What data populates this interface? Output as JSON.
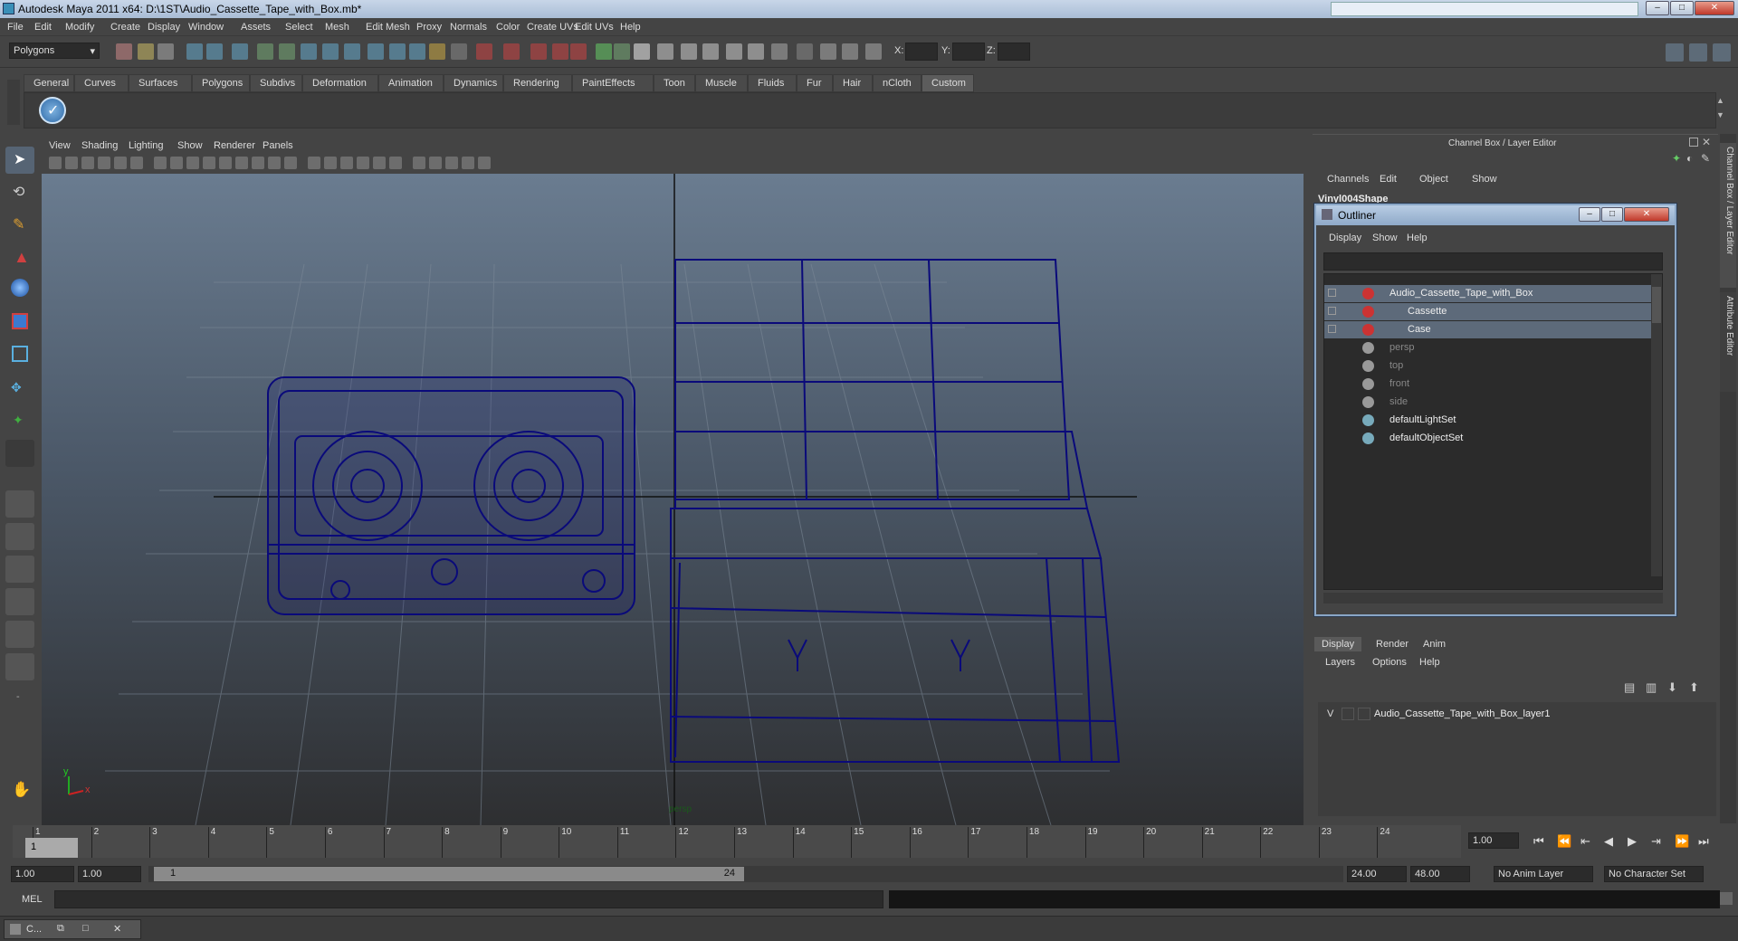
{
  "window": {
    "title": "Autodesk Maya 2011 x64: D:\\1ST\\Audio_Cassette_Tape_with_Box.mb*",
    "minimize": "–",
    "maximize": "□",
    "close": "✕"
  },
  "menubar": [
    "File",
    "Edit",
    "Modify",
    "Create",
    "Display",
    "Window",
    "Assets",
    "Select",
    "Mesh",
    "Edit Mesh",
    "Proxy",
    "Normals",
    "Color",
    "Create UVs",
    "Edit UVs",
    "Help"
  ],
  "status_line": {
    "mode": "Polygons",
    "x_label": "X:",
    "y_label": "Y:",
    "z_label": "Z:"
  },
  "shelf_tabs": [
    "General",
    "Curves",
    "Surfaces",
    "Polygons",
    "Subdivs",
    "Deformation",
    "Animation",
    "Dynamics",
    "Rendering",
    "PaintEffects",
    "Toon",
    "Muscle",
    "Fluids",
    "Fur",
    "Hair",
    "nCloth",
    "Custom"
  ],
  "active_shelf_tab": "Custom",
  "viewport": {
    "menu": [
      "View",
      "Shading",
      "Lighting",
      "Show",
      "Renderer",
      "Panels"
    ],
    "camera_label": "persp",
    "axis_x": "x",
    "axis_y": "y"
  },
  "channel_box": {
    "header": "Channel Box / Layer Editor",
    "menu": [
      "Channels",
      "Edit",
      "Object",
      "Show"
    ],
    "object_name": "Vinyl004Shape",
    "side_tab_1": "Channel Box / Layer Editor",
    "side_tab_2": "Attribute Editor"
  },
  "outliner": {
    "title": "Outliner",
    "menu": [
      "Display",
      "Show",
      "Help"
    ],
    "items": [
      {
        "label": "Audio_Cassette_Tape_with_Box",
        "selected": true,
        "dim": false
      },
      {
        "label": "Cassette",
        "selected": true,
        "dim": false
      },
      {
        "label": "Case",
        "selected": true,
        "dim": false
      },
      {
        "label": "persp",
        "selected": false,
        "dim": true
      },
      {
        "label": "top",
        "selected": false,
        "dim": true
      },
      {
        "label": "front",
        "selected": false,
        "dim": true
      },
      {
        "label": "side",
        "selected": false,
        "dim": true
      },
      {
        "label": "defaultLightSet",
        "selected": false,
        "dim": false
      },
      {
        "label": "defaultObjectSet",
        "selected": false,
        "dim": false
      }
    ]
  },
  "layer_editor": {
    "tabs": [
      "Display",
      "Render",
      "Anim"
    ],
    "menu": [
      "Layers",
      "Options",
      "Help"
    ],
    "layer_visible": "V",
    "layer_name": "Audio_Cassette_Tape_with_Box_layer1"
  },
  "time_slider": {
    "ticks": [
      "1",
      "2",
      "3",
      "4",
      "5",
      "6",
      "7",
      "8",
      "9",
      "10",
      "11",
      "12",
      "13",
      "14",
      "15",
      "16",
      "17",
      "18",
      "19",
      "20",
      "21",
      "22",
      "23",
      "24"
    ],
    "current_frame": "1",
    "current_time_field": "1.00"
  },
  "range_slider": {
    "start_time": "1.00",
    "playback_start": "1.00",
    "range_start_label": "1",
    "range_end_label": "24",
    "playback_end": "24.00",
    "end_time": "48.00",
    "anim_layer": "No Anim Layer",
    "character_set": "No Character Set"
  },
  "command_line": {
    "label": "MEL"
  },
  "taskbar": {
    "item": "C..."
  },
  "colors": {
    "wireframe": "#0a0a7a",
    "selection_highlight": "#5d6a7a",
    "title_bar": "#b8cde4"
  }
}
